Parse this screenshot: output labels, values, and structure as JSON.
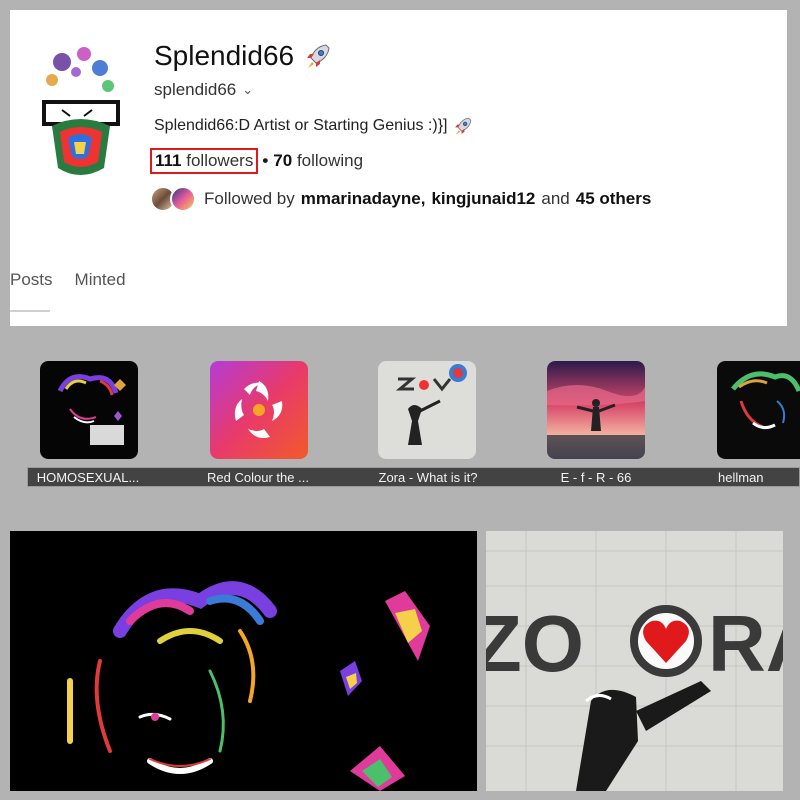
{
  "profile": {
    "display_name": "Splendid66",
    "handle": "splendid66",
    "bio": "Splendid66:D Artist or Starting Genius :)}]",
    "followers_count": "111",
    "followers_label": "followers",
    "separator": "•",
    "following_count": "70",
    "following_label": "following",
    "followed_by_prefix": "Followed by",
    "followed_by_user1": "mmarinadayne,",
    "followed_by_user2": "kingjunaid12",
    "followed_by_and": "and",
    "followed_by_others": "45 others"
  },
  "tabs": [
    "Posts",
    "Minted"
  ],
  "highlights": [
    {
      "label": "HOMOSEXUAL..."
    },
    {
      "label": "Red Colour the ..."
    },
    {
      "label": "Zora - What is it?"
    },
    {
      "label": "E - f - R - 66"
    },
    {
      "label": "hellman"
    }
  ],
  "posts": {
    "post2_logo_text_left": "ZO",
    "post2_logo_text_right": "RA"
  },
  "colors": {
    "highlight_box": "#e01a1a",
    "label_bar": "#434343",
    "background": "#b3b3b3"
  },
  "icons": {
    "rocket": "rocket-icon",
    "chevron": "chevron-down-icon"
  }
}
